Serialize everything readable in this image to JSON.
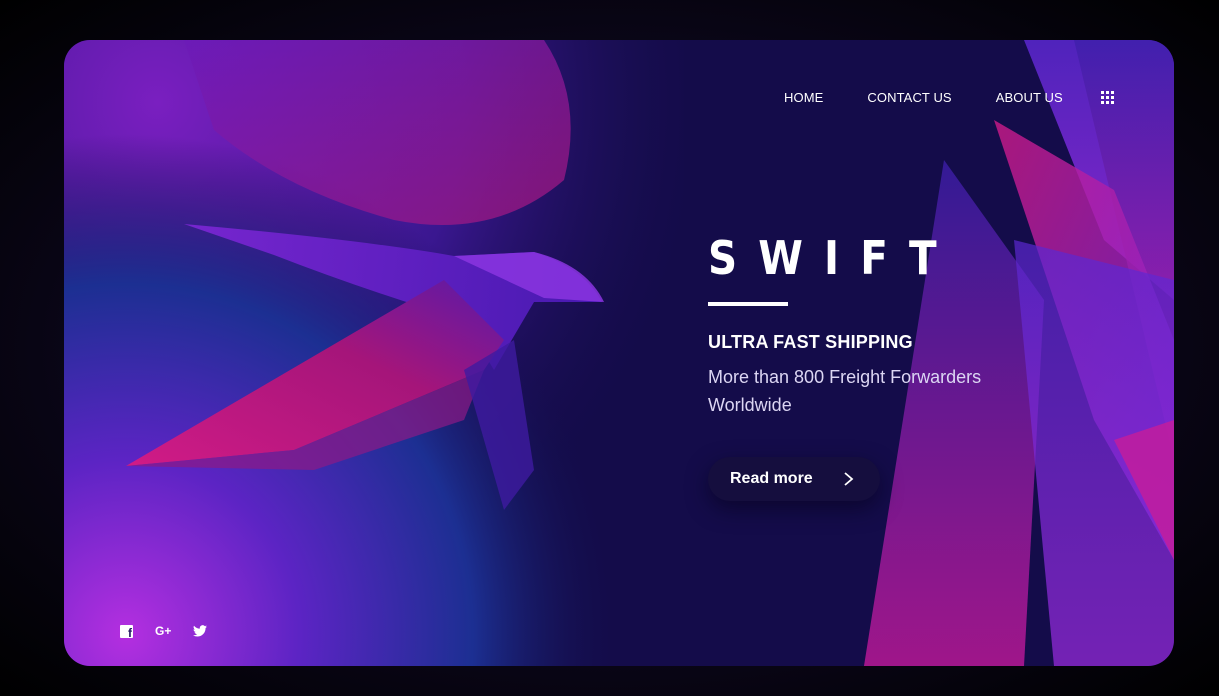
{
  "nav": {
    "items": [
      {
        "label": "HOME"
      },
      {
        "label": "CONTACT US"
      },
      {
        "label": "ABOUT US"
      }
    ],
    "menu_icon": "grid-dots-icon"
  },
  "hero": {
    "brand": "SWIFT",
    "tagline": "ULTRA FAST SHIPPING",
    "subline": "More than 800 Freight Forwarders Worldwide",
    "cta_label": "Read more",
    "cta_icon": "chevron-right-icon"
  },
  "social": [
    {
      "icon": "facebook-icon",
      "glyph": ""
    },
    {
      "icon": "google-plus-icon",
      "glyph": "G+"
    },
    {
      "icon": "twitter-icon",
      "glyph": ""
    }
  ],
  "colors": {
    "background": "#140c4a",
    "accent_magenta": "#c01482",
    "accent_purple": "#7a2ad8",
    "text": "#ffffff"
  }
}
